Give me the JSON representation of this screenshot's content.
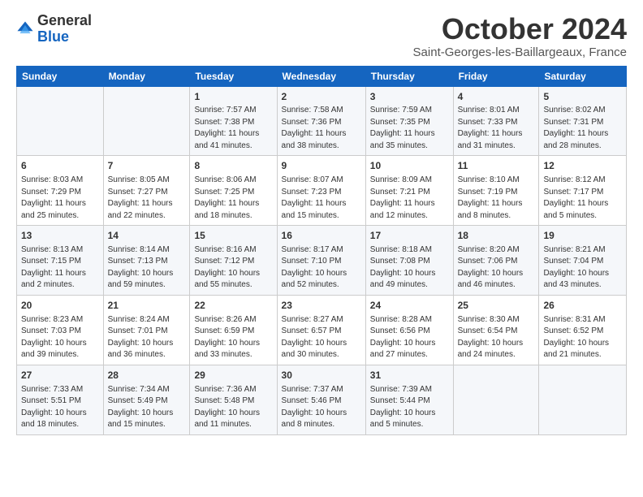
{
  "logo": {
    "general": "General",
    "blue": "Blue"
  },
  "header": {
    "month": "October 2024",
    "location": "Saint-Georges-les-Baillargeaux, France"
  },
  "weekdays": [
    "Sunday",
    "Monday",
    "Tuesday",
    "Wednesday",
    "Thursday",
    "Friday",
    "Saturday"
  ],
  "weeks": [
    [
      {
        "day": "",
        "sunrise": "",
        "sunset": "",
        "daylight": ""
      },
      {
        "day": "",
        "sunrise": "",
        "sunset": "",
        "daylight": ""
      },
      {
        "day": "1",
        "sunrise": "Sunrise: 7:57 AM",
        "sunset": "Sunset: 7:38 PM",
        "daylight": "Daylight: 11 hours and 41 minutes."
      },
      {
        "day": "2",
        "sunrise": "Sunrise: 7:58 AM",
        "sunset": "Sunset: 7:36 PM",
        "daylight": "Daylight: 11 hours and 38 minutes."
      },
      {
        "day": "3",
        "sunrise": "Sunrise: 7:59 AM",
        "sunset": "Sunset: 7:35 PM",
        "daylight": "Daylight: 11 hours and 35 minutes."
      },
      {
        "day": "4",
        "sunrise": "Sunrise: 8:01 AM",
        "sunset": "Sunset: 7:33 PM",
        "daylight": "Daylight: 11 hours and 31 minutes."
      },
      {
        "day": "5",
        "sunrise": "Sunrise: 8:02 AM",
        "sunset": "Sunset: 7:31 PM",
        "daylight": "Daylight: 11 hours and 28 minutes."
      }
    ],
    [
      {
        "day": "6",
        "sunrise": "Sunrise: 8:03 AM",
        "sunset": "Sunset: 7:29 PM",
        "daylight": "Daylight: 11 hours and 25 minutes."
      },
      {
        "day": "7",
        "sunrise": "Sunrise: 8:05 AM",
        "sunset": "Sunset: 7:27 PM",
        "daylight": "Daylight: 11 hours and 22 minutes."
      },
      {
        "day": "8",
        "sunrise": "Sunrise: 8:06 AM",
        "sunset": "Sunset: 7:25 PM",
        "daylight": "Daylight: 11 hours and 18 minutes."
      },
      {
        "day": "9",
        "sunrise": "Sunrise: 8:07 AM",
        "sunset": "Sunset: 7:23 PM",
        "daylight": "Daylight: 11 hours and 15 minutes."
      },
      {
        "day": "10",
        "sunrise": "Sunrise: 8:09 AM",
        "sunset": "Sunset: 7:21 PM",
        "daylight": "Daylight: 11 hours and 12 minutes."
      },
      {
        "day": "11",
        "sunrise": "Sunrise: 8:10 AM",
        "sunset": "Sunset: 7:19 PM",
        "daylight": "Daylight: 11 hours and 8 minutes."
      },
      {
        "day": "12",
        "sunrise": "Sunrise: 8:12 AM",
        "sunset": "Sunset: 7:17 PM",
        "daylight": "Daylight: 11 hours and 5 minutes."
      }
    ],
    [
      {
        "day": "13",
        "sunrise": "Sunrise: 8:13 AM",
        "sunset": "Sunset: 7:15 PM",
        "daylight": "Daylight: 11 hours and 2 minutes."
      },
      {
        "day": "14",
        "sunrise": "Sunrise: 8:14 AM",
        "sunset": "Sunset: 7:13 PM",
        "daylight": "Daylight: 10 hours and 59 minutes."
      },
      {
        "day": "15",
        "sunrise": "Sunrise: 8:16 AM",
        "sunset": "Sunset: 7:12 PM",
        "daylight": "Daylight: 10 hours and 55 minutes."
      },
      {
        "day": "16",
        "sunrise": "Sunrise: 8:17 AM",
        "sunset": "Sunset: 7:10 PM",
        "daylight": "Daylight: 10 hours and 52 minutes."
      },
      {
        "day": "17",
        "sunrise": "Sunrise: 8:18 AM",
        "sunset": "Sunset: 7:08 PM",
        "daylight": "Daylight: 10 hours and 49 minutes."
      },
      {
        "day": "18",
        "sunrise": "Sunrise: 8:20 AM",
        "sunset": "Sunset: 7:06 PM",
        "daylight": "Daylight: 10 hours and 46 minutes."
      },
      {
        "day": "19",
        "sunrise": "Sunrise: 8:21 AM",
        "sunset": "Sunset: 7:04 PM",
        "daylight": "Daylight: 10 hours and 43 minutes."
      }
    ],
    [
      {
        "day": "20",
        "sunrise": "Sunrise: 8:23 AM",
        "sunset": "Sunset: 7:03 PM",
        "daylight": "Daylight: 10 hours and 39 minutes."
      },
      {
        "day": "21",
        "sunrise": "Sunrise: 8:24 AM",
        "sunset": "Sunset: 7:01 PM",
        "daylight": "Daylight: 10 hours and 36 minutes."
      },
      {
        "day": "22",
        "sunrise": "Sunrise: 8:26 AM",
        "sunset": "Sunset: 6:59 PM",
        "daylight": "Daylight: 10 hours and 33 minutes."
      },
      {
        "day": "23",
        "sunrise": "Sunrise: 8:27 AM",
        "sunset": "Sunset: 6:57 PM",
        "daylight": "Daylight: 10 hours and 30 minutes."
      },
      {
        "day": "24",
        "sunrise": "Sunrise: 8:28 AM",
        "sunset": "Sunset: 6:56 PM",
        "daylight": "Daylight: 10 hours and 27 minutes."
      },
      {
        "day": "25",
        "sunrise": "Sunrise: 8:30 AM",
        "sunset": "Sunset: 6:54 PM",
        "daylight": "Daylight: 10 hours and 24 minutes."
      },
      {
        "day": "26",
        "sunrise": "Sunrise: 8:31 AM",
        "sunset": "Sunset: 6:52 PM",
        "daylight": "Daylight: 10 hours and 21 minutes."
      }
    ],
    [
      {
        "day": "27",
        "sunrise": "Sunrise: 7:33 AM",
        "sunset": "Sunset: 5:51 PM",
        "daylight": "Daylight: 10 hours and 18 minutes."
      },
      {
        "day": "28",
        "sunrise": "Sunrise: 7:34 AM",
        "sunset": "Sunset: 5:49 PM",
        "daylight": "Daylight: 10 hours and 15 minutes."
      },
      {
        "day": "29",
        "sunrise": "Sunrise: 7:36 AM",
        "sunset": "Sunset: 5:48 PM",
        "daylight": "Daylight: 10 hours and 11 minutes."
      },
      {
        "day": "30",
        "sunrise": "Sunrise: 7:37 AM",
        "sunset": "Sunset: 5:46 PM",
        "daylight": "Daylight: 10 hours and 8 minutes."
      },
      {
        "day": "31",
        "sunrise": "Sunrise: 7:39 AM",
        "sunset": "Sunset: 5:44 PM",
        "daylight": "Daylight: 10 hours and 5 minutes."
      },
      {
        "day": "",
        "sunrise": "",
        "sunset": "",
        "daylight": ""
      },
      {
        "day": "",
        "sunrise": "",
        "sunset": "",
        "daylight": ""
      }
    ]
  ]
}
